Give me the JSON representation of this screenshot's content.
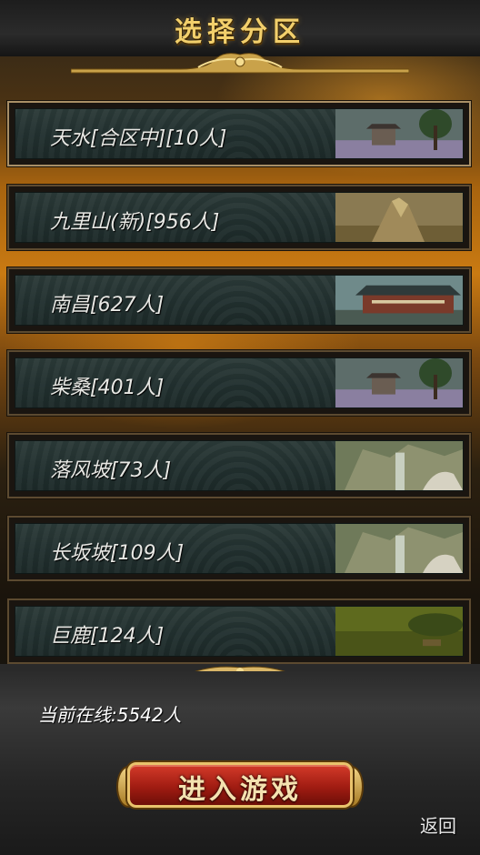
{
  "header": {
    "title": "选择分区"
  },
  "servers": [
    {
      "label": "天水[合区中][10人]",
      "scene": "pavilion"
    },
    {
      "label": "九里山(新)[956人]",
      "scene": "mountain"
    },
    {
      "label": "南昌[627人]",
      "scene": "palace"
    },
    {
      "label": "柴桑[401人]",
      "scene": "pavilion"
    },
    {
      "label": "落风坡[73人]",
      "scene": "waterfall"
    },
    {
      "label": "长坂坡[109人]",
      "scene": "waterfall"
    },
    {
      "label": "巨鹿[124人]",
      "scene": "plain"
    }
  ],
  "footer": {
    "online_text": "当前在线:5542人",
    "enter_button": "进入游戏",
    "back_button": "返回"
  },
  "colors": {
    "title_gold": "#f2cf6b",
    "row_teal": "#223130",
    "frame_bronze": "#5c4a30",
    "button_red": "#a11c12"
  }
}
